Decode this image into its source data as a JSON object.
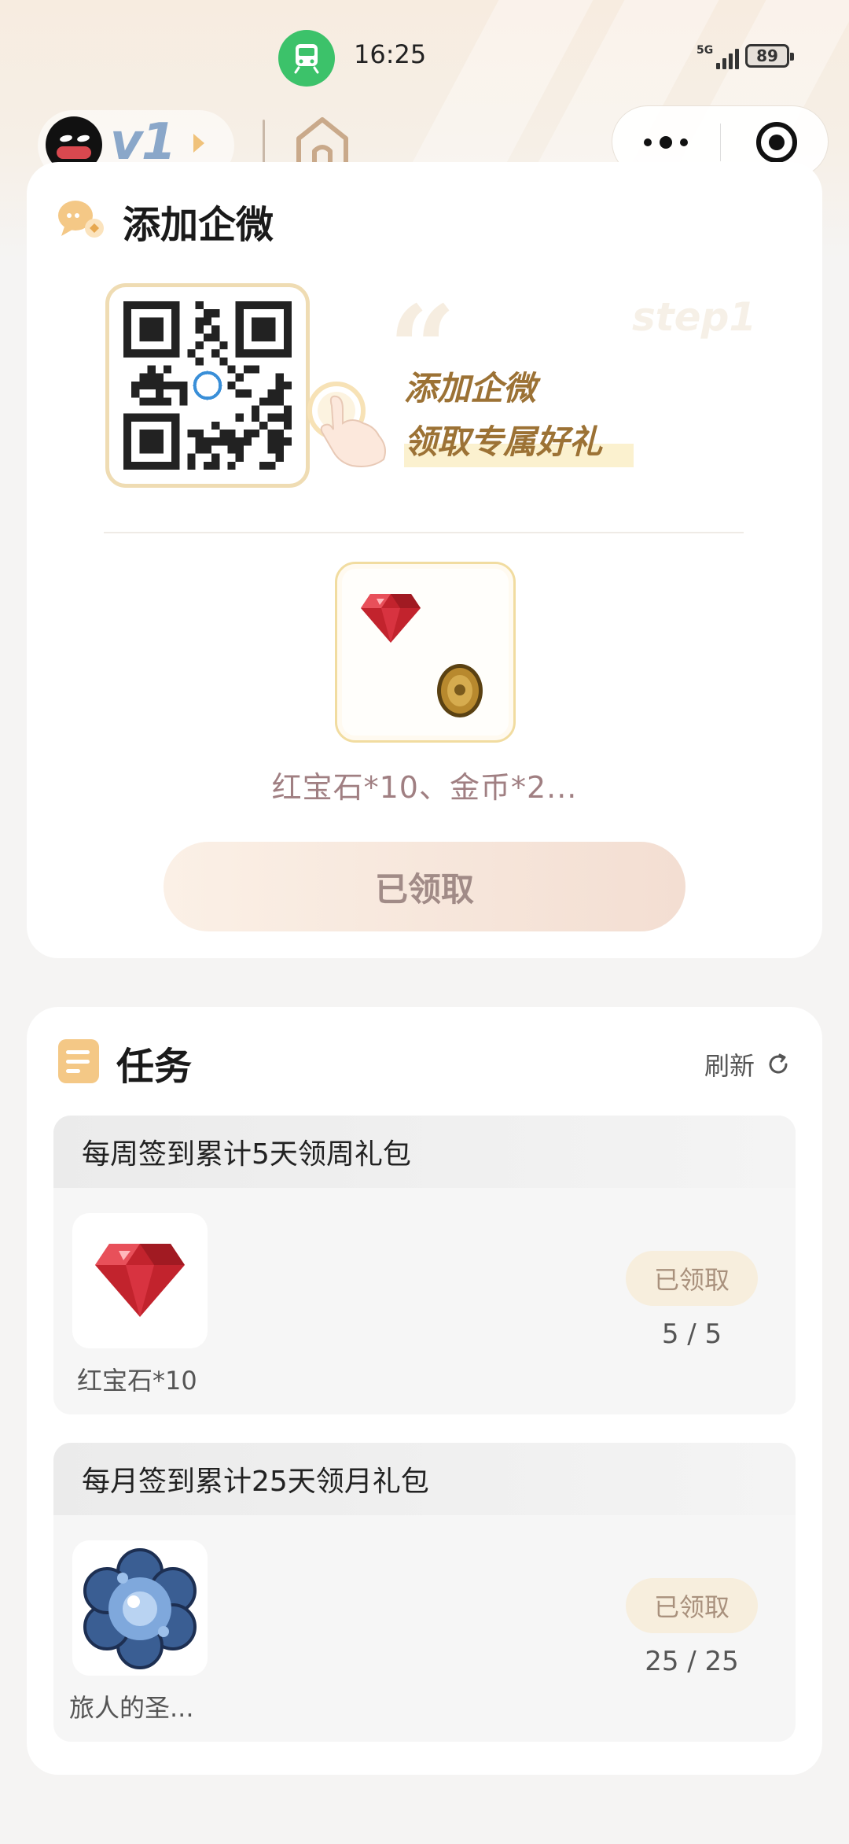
{
  "status_bar": {
    "time": "16:25",
    "network": "5G",
    "battery": "89"
  },
  "nav": {
    "level": "v1"
  },
  "wecom": {
    "title": "添加企微",
    "step": "step1",
    "slogan_line1": "添加企微",
    "slogan_line2": "领取专属好礼",
    "reward_names": "红宝石*10、金币*2...",
    "claim_label": "已领取"
  },
  "tasks": {
    "title": "任务",
    "refresh_label": "刷新",
    "items": [
      {
        "title": "每周签到累计5天领周礼包",
        "reward_name": "红宝石*10",
        "status": "已领取",
        "progress": "5 / 5"
      },
      {
        "title": "每月签到累计25天领月礼包",
        "reward_name": "旅人的圣...",
        "status": "已领取",
        "progress": "25 / 25"
      }
    ]
  },
  "colors": {
    "accent_gold": "#9c7235",
    "reward_text": "#a07f82",
    "train_green": "#3cc26a"
  },
  "icons": [
    "train-icon",
    "home-icon",
    "more-icon",
    "close-target-icon",
    "chat-bubble-icon",
    "document-icon",
    "refresh-icon",
    "ruby-icon",
    "gold-coin-icon",
    "crystal-flower-icon",
    "pointing-hand-icon"
  ]
}
